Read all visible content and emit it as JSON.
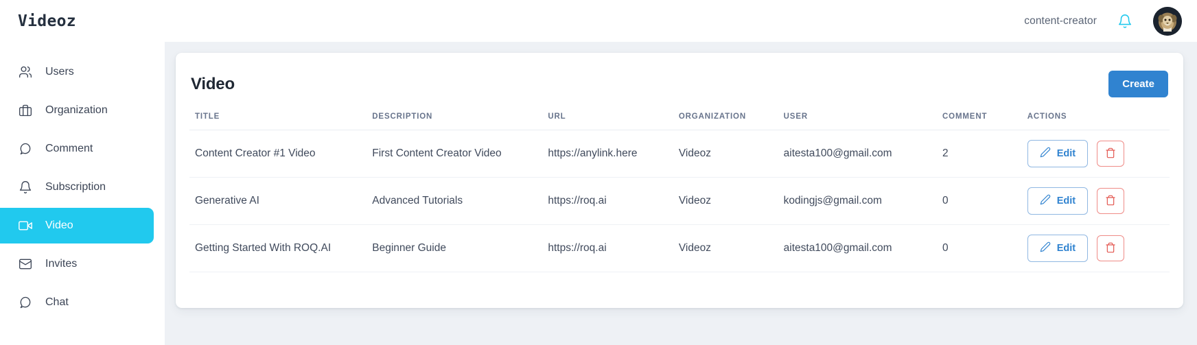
{
  "header": {
    "brand": "Videoz",
    "user_tag": "content-creator",
    "bell_icon": "bell-icon",
    "avatar_icon": "user-avatar"
  },
  "sidebar": {
    "items": [
      {
        "label": "Users",
        "icon": "users-icon",
        "active": false
      },
      {
        "label": "Organization",
        "icon": "briefcase-icon",
        "active": false
      },
      {
        "label": "Comment",
        "icon": "comment-icon",
        "active": false
      },
      {
        "label": "Subscription",
        "icon": "bell-icon",
        "active": false
      },
      {
        "label": "Video",
        "icon": "video-camera-icon",
        "active": true
      },
      {
        "label": "Invites",
        "icon": "envelope-icon",
        "active": false
      },
      {
        "label": "Chat",
        "icon": "chat-icon",
        "active": false
      }
    ]
  },
  "main": {
    "title": "Video",
    "create_label": "Create",
    "columns": [
      "TITLE",
      "DESCRIPTION",
      "URL",
      "ORGANIZATION",
      "USER",
      "COMMENT",
      "ACTIONS"
    ],
    "rows": [
      {
        "title": "Content Creator #1 Video",
        "description": "First Content Creator Video",
        "url": "https://anylink.here",
        "organization": "Videoz",
        "user": "aitesta100@gmail.com",
        "comment": "2",
        "edit_label": "Edit",
        "delete_label": ""
      },
      {
        "title": "Generative AI",
        "description": "Advanced Tutorials",
        "url": "https://roq.ai",
        "organization": "Videoz",
        "user": "kodingjs@gmail.com",
        "comment": "0",
        "edit_label": "Edit",
        "delete_label": ""
      },
      {
        "title": "Getting Started With ROQ.AI",
        "description": "Beginner Guide",
        "url": "https://roq.ai",
        "organization": "Videoz",
        "user": "aitesta100@gmail.com",
        "comment": "0",
        "edit_label": "Edit",
        "delete_label": ""
      }
    ]
  },
  "colors": {
    "accent_cyan": "#21c9ee",
    "primary_blue": "#3083d0",
    "danger_red": "#ef8b87",
    "page_bg": "#eef1f5"
  }
}
